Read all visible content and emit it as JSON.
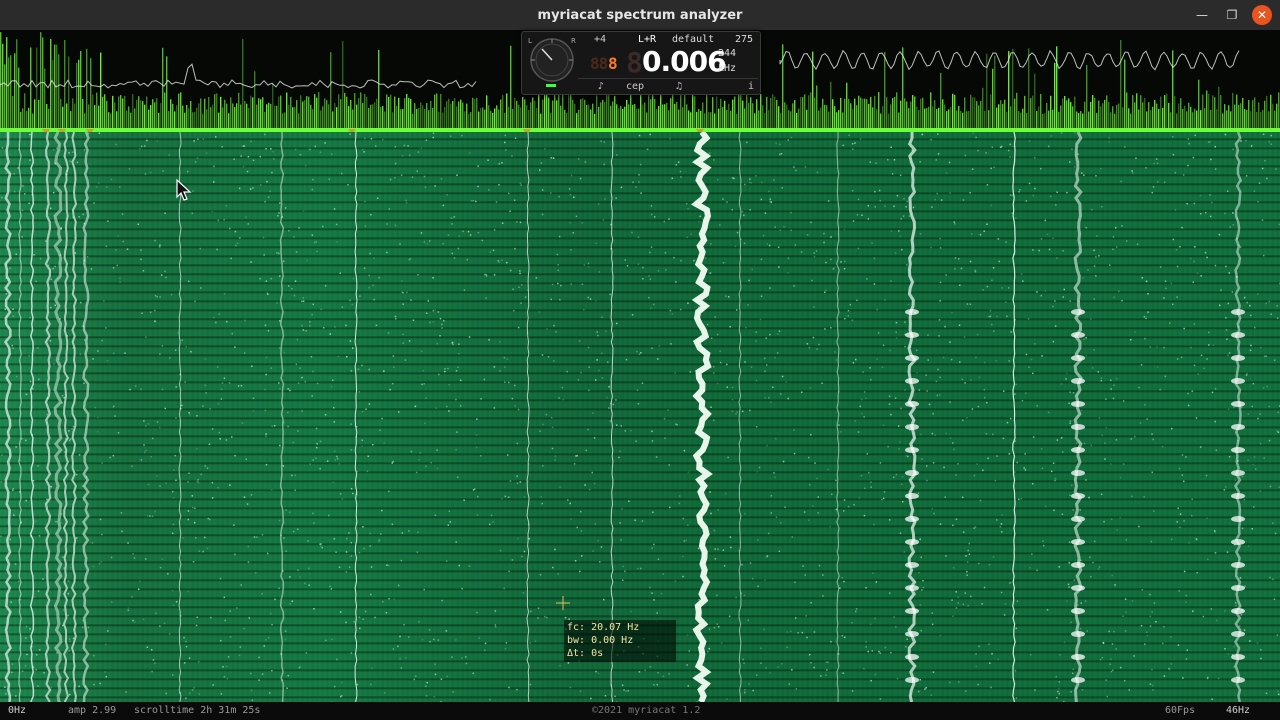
{
  "window": {
    "title": "myriacat spectrum analyzer"
  },
  "widget": {
    "plus": "+4",
    "channel": "L+R",
    "preset": "default",
    "count": "275",
    "seg_dim": "88",
    "seg_lit": "8",
    "freq_dim": "8",
    "frequency": "0.006",
    "sub_value": "244",
    "unit": "kHz",
    "buttons": [
      "♪",
      "cep",
      "♫",
      "i"
    ]
  },
  "tooltip": {
    "fc": "fc: 20.07 Hz",
    "bw": "bw: 0.00 Hz",
    "dt": "Δt: 0s"
  },
  "status": {
    "left_freq": "0Hz",
    "amp": "amp 2.99",
    "scrolltime": "scrolltime 2h 31m 25s",
    "copyright": "©2021 myriacat 1.2",
    "fps": "60Fps",
    "right_freq": "46Hz"
  },
  "colors": {
    "spectrum": "#6cff3a",
    "waterfall": "#11703e",
    "close_button": "#e95420",
    "segment_lit": "#ff7a2a"
  }
}
